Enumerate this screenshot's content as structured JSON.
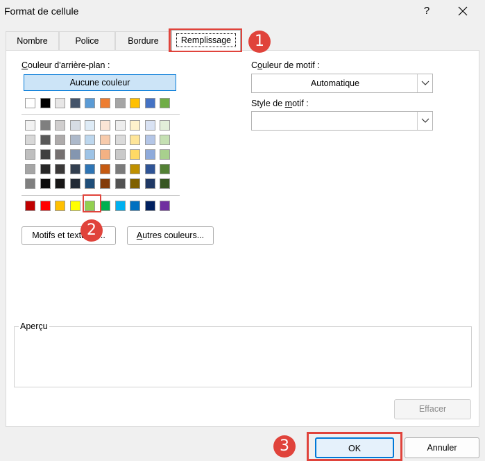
{
  "dialog": {
    "title": "Format de cellule",
    "help_label": "?",
    "close_label": "✕"
  },
  "tabs": [
    {
      "label": "Nombre",
      "active": false
    },
    {
      "label": "Police",
      "active": false
    },
    {
      "label": "Bordure",
      "active": false
    },
    {
      "label": "Remplissage",
      "active": true
    }
  ],
  "fill": {
    "background_label_prefix": "",
    "background_label_accel": "C",
    "background_label_rest": "ouleur d'arrière-plan :",
    "no_color_label": "Aucune couleur",
    "standard_row_1": [
      "#ffffff",
      "#000000",
      "#e7e6e6",
      "#44546a",
      "#5b9bd5",
      "#ed7d31",
      "#a5a5a5",
      "#ffc000",
      "#4472c4",
      "#70ad47"
    ],
    "theme_rows": [
      [
        "#f2f2f2",
        "#7f7f7f",
        "#d0cece",
        "#d6dce4",
        "#deebf6",
        "#fbe5d5",
        "#ededed",
        "#fff2cc",
        "#d9e2f3",
        "#e2efd9"
      ],
      [
        "#d8d8d8",
        "#595959",
        "#aeabab",
        "#adb9ca",
        "#bdd7ee",
        "#f7cbac",
        "#dbdbdb",
        "#fee599",
        "#b4c6e7",
        "#c5e0b3"
      ],
      [
        "#bfbfbf",
        "#3f3f3f",
        "#757070",
        "#8496b0",
        "#9dc3e6",
        "#f4b183",
        "#c9c9c9",
        "#ffd965",
        "#8eaadb",
        "#a8d08d"
      ],
      [
        "#a5a5a5",
        "#262626",
        "#3a3838",
        "#323f4f",
        "#2e75b5",
        "#c55a11",
        "#7b7b7b",
        "#bf9000",
        "#2f5496",
        "#538135"
      ],
      [
        "#7f7f7f",
        "#0c0c0c",
        "#171616",
        "#222a35",
        "#1f4e79",
        "#833c0b",
        "#525252",
        "#7f6000",
        "#1f3864",
        "#375623"
      ]
    ],
    "standard_colors": [
      "#c00000",
      "#ff0000",
      "#ffc000",
      "#ffff00",
      "#92d050",
      "#00b050",
      "#00b0f0",
      "#0070c0",
      "#002060",
      "#7030a0"
    ],
    "selected_color_index": 4,
    "patterns_button_label": "Motifs et textures...",
    "more_colors_accel": "A",
    "more_colors_rest": "utres couleurs..."
  },
  "pattern": {
    "color_label_pre": "C",
    "color_label_accel": "o",
    "color_label_rest": "uleur de motif :",
    "color_value": "Automatique",
    "style_label_pre": "Style de ",
    "style_label_accel": "m",
    "style_label_rest": "otif :",
    "style_value": ""
  },
  "preview": {
    "label": "Aperçu"
  },
  "buttons": {
    "clear_label": "Effacer",
    "ok_label": "OK",
    "cancel_label": "Annuler"
  },
  "annotations": {
    "step1": "1",
    "step2": "2",
    "step3": "3",
    "accent_color": "#e0433b"
  }
}
